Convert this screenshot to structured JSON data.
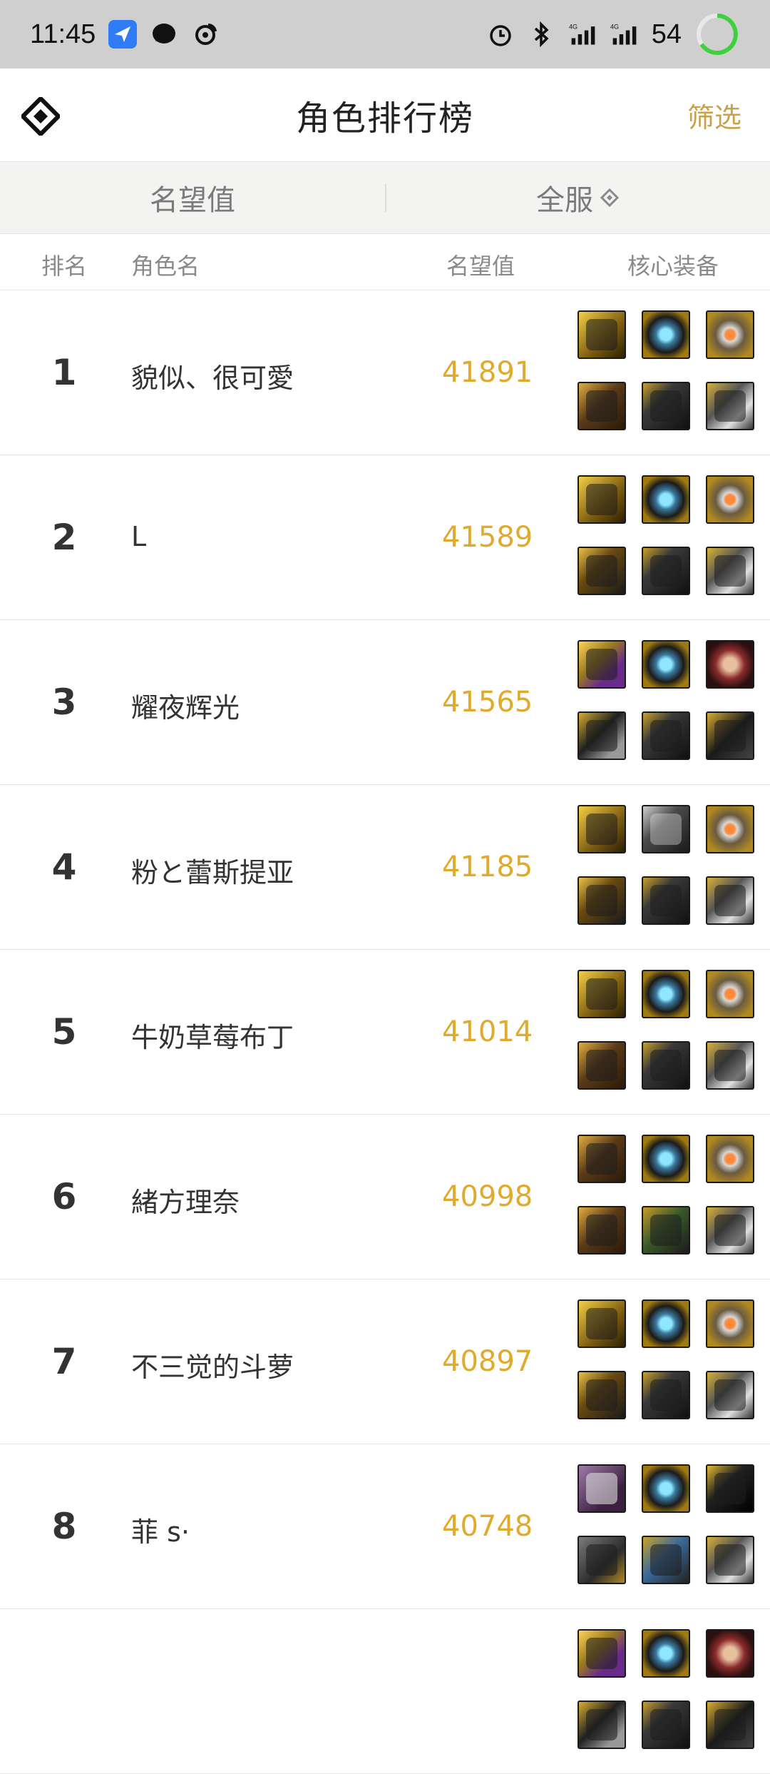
{
  "status_bar": {
    "time": "11:45",
    "battery": "54",
    "icons_left": [
      "navigation-arrow-icon",
      "chat-bubble-icon",
      "weibo-icon"
    ],
    "icons_right": [
      "alarm-icon",
      "bluetooth-icon",
      "signal-4g-icon",
      "signal-4g-icon",
      "battery-ring-icon"
    ]
  },
  "header": {
    "title": "角色排行榜",
    "filter_label": "筛选"
  },
  "tabs": [
    {
      "label": "名望值"
    },
    {
      "label": "全服"
    }
  ],
  "columns": {
    "rank": "排名",
    "name": "角色名",
    "score": "名望值",
    "gear": "核心装备"
  },
  "accent_color": "#c8a24a",
  "score_color": "#e0ab2c",
  "rows": [
    {
      "rank": "1",
      "name": "貌似、很可愛",
      "score": "41891",
      "gear": [
        "g-gold",
        "g-cyan",
        "g-atom",
        "g-brown",
        "g-dark",
        "g-arm"
      ]
    },
    {
      "rank": "2",
      "name": "L",
      "score": "41589",
      "gear": [
        "g-gold",
        "g-cyan",
        "g-atom",
        "g-claw",
        "g-dark",
        "g-arm"
      ]
    },
    {
      "rank": "3",
      "name": "耀夜辉光",
      "score": "41565",
      "gear": [
        "g-purpleclaw",
        "g-cyan",
        "g-red",
        "g-headset",
        "g-dark",
        "g-pants"
      ]
    },
    {
      "rank": "4",
      "name": "粉と蕾斯提亚",
      "score": "41185",
      "gear": [
        "g-gold",
        "g-ring",
        "g-atom",
        "g-claw",
        "g-dark",
        "g-arm"
      ]
    },
    {
      "rank": "5",
      "name": "牛奶草莓布丁",
      "score": "41014",
      "gear": [
        "g-gold",
        "g-cyan",
        "g-atom",
        "g-brown",
        "g-dark",
        "g-arm"
      ]
    },
    {
      "rank": "6",
      "name": "緒方理奈",
      "score": "40998",
      "gear": [
        "g-brown",
        "g-cyan",
        "g-atom",
        "g-brown",
        "g-green",
        "g-arm"
      ]
    },
    {
      "rank": "7",
      "name": "不三觉的斗萝",
      "score": "40897",
      "gear": [
        "g-gold",
        "g-cyan",
        "g-atom",
        "g-claw",
        "g-dark",
        "g-arm"
      ]
    },
    {
      "rank": "8",
      "name": "菲 s·",
      "score": "40748",
      "gear": [
        "g-purple",
        "g-cyan",
        "g-belt",
        "g-silver",
        "g-blue",
        "g-arm"
      ]
    },
    {
      "rank": "",
      "name": "",
      "score": "",
      "gear": [
        "g-purpleclaw",
        "g-cyan",
        "g-red",
        "g-headset",
        "g-dark",
        "g-pants"
      ]
    }
  ]
}
